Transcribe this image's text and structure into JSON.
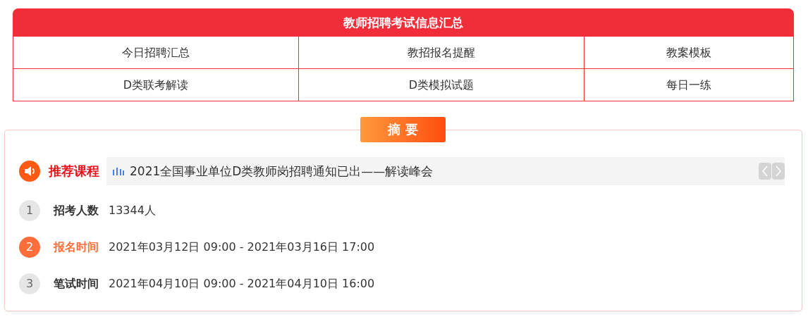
{
  "header": {
    "title": "教师招聘考试信息汇总"
  },
  "links": [
    {
      "label": "今日招聘汇总"
    },
    {
      "label": "教招报名提醒"
    },
    {
      "label": "教案模板"
    },
    {
      "label": "D类联考解读"
    },
    {
      "label": "D类模拟试题"
    },
    {
      "label": "每日一练"
    }
  ],
  "summary": {
    "badge": "摘 要",
    "recommend": {
      "label": "推荐课程",
      "text": "2021全国事业单位D类教师岗招聘通知已出——解读峰会"
    },
    "items": [
      {
        "number": "1",
        "label": "招考人数",
        "value": "13344人",
        "selected": false
      },
      {
        "number": "2",
        "label": "报名时间",
        "value": "2021年03月12日 09:00 - 2021年03月16日 17:00",
        "selected": true
      },
      {
        "number": "3",
        "label": "笔试时间",
        "value": "2021年04月10日 09:00 - 2021年04月10日 16:00",
        "selected": false
      }
    ]
  }
}
